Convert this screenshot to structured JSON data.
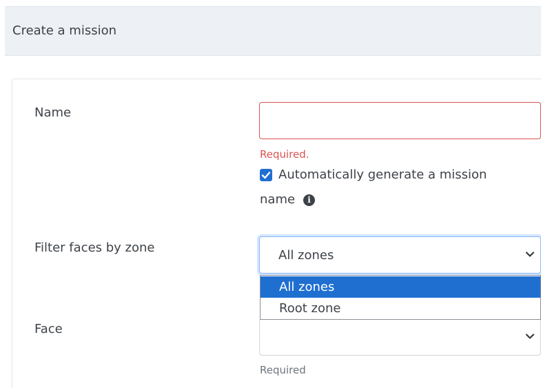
{
  "header": {
    "title": "Create a mission"
  },
  "form": {
    "name": {
      "label": "Name",
      "value": "",
      "error": "Required.",
      "auto_generate": {
        "checked": true,
        "label_line1": "Automatically generate a mission",
        "label_line2": "name",
        "info_icon": "info-circle-icon"
      }
    },
    "zone_filter": {
      "label": "Filter faces by zone",
      "selected": "All zones",
      "options": [
        "All zones",
        "Root zone"
      ],
      "open": true
    },
    "face": {
      "label": "Face",
      "selected": "",
      "hint": "Required"
    }
  },
  "colors": {
    "error": "#d9534f",
    "accent": "#1f6fd1",
    "header_bg": "#edf1f5"
  }
}
